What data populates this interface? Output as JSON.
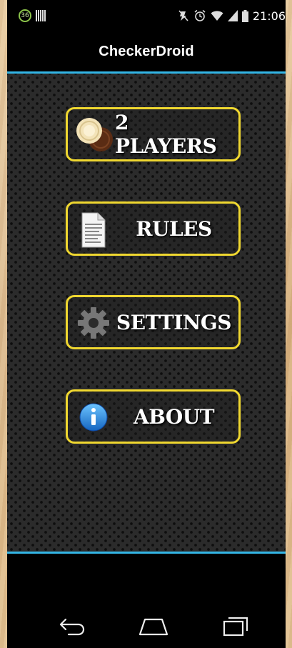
{
  "status_bar": {
    "notification_count": "36",
    "time": "21:06",
    "icons": [
      "notification-count-icon",
      "barcode-icon",
      "mute-icon",
      "alarm-icon",
      "wifi-icon",
      "signal-icon",
      "battery-icon"
    ]
  },
  "action_bar": {
    "title": "CheckerDroid"
  },
  "menu": {
    "players_label": "2 PLAYERS",
    "rules_label": "RULES",
    "settings_label": "SETTINGS",
    "about_label": "ABOUT",
    "border_color": "#f0d830"
  },
  "colors": {
    "accent_divider": "#33b5e5",
    "content_background": "#2b2b2b"
  },
  "nav_bar": {
    "icons": [
      "back-icon",
      "home-icon",
      "recent-apps-icon"
    ]
  }
}
